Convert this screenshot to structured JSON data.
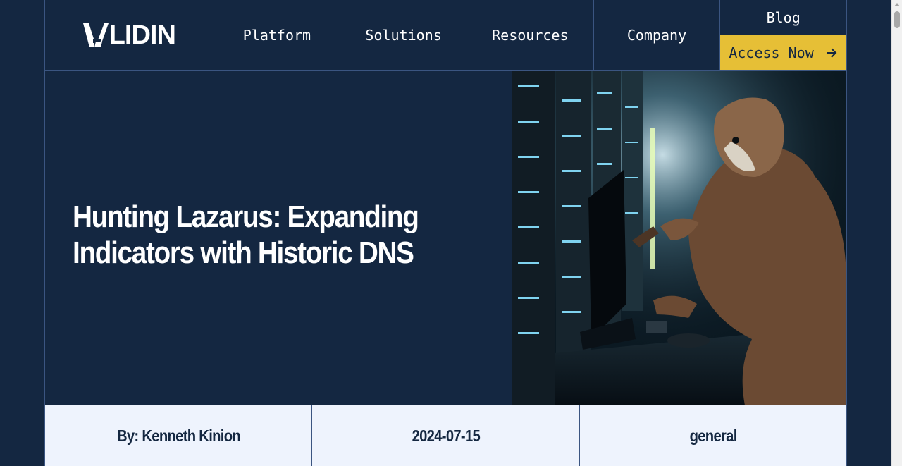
{
  "brand": {
    "logo_text": "LIDIN"
  },
  "nav": {
    "items": [
      {
        "label": "Platform"
      },
      {
        "label": "Solutions"
      },
      {
        "label": "Resources"
      },
      {
        "label": "Company"
      }
    ],
    "blog_label": "Blog",
    "cta_label": "Access Now"
  },
  "hero": {
    "title_line1": "Hunting Lazarus: Expanding",
    "title_line2": "Indicators with Historic DNS"
  },
  "meta": {
    "author": "By: Kenneth Kinion",
    "date": "2024-07-15",
    "category": "general"
  },
  "colors": {
    "background": "#142741",
    "accent": "#e6bf36",
    "meta_bg": "#eef3fd",
    "divider": "#3b5581"
  },
  "icons": {
    "cta": "arrow-right-icon",
    "logo": "validin-v-mark-icon"
  }
}
